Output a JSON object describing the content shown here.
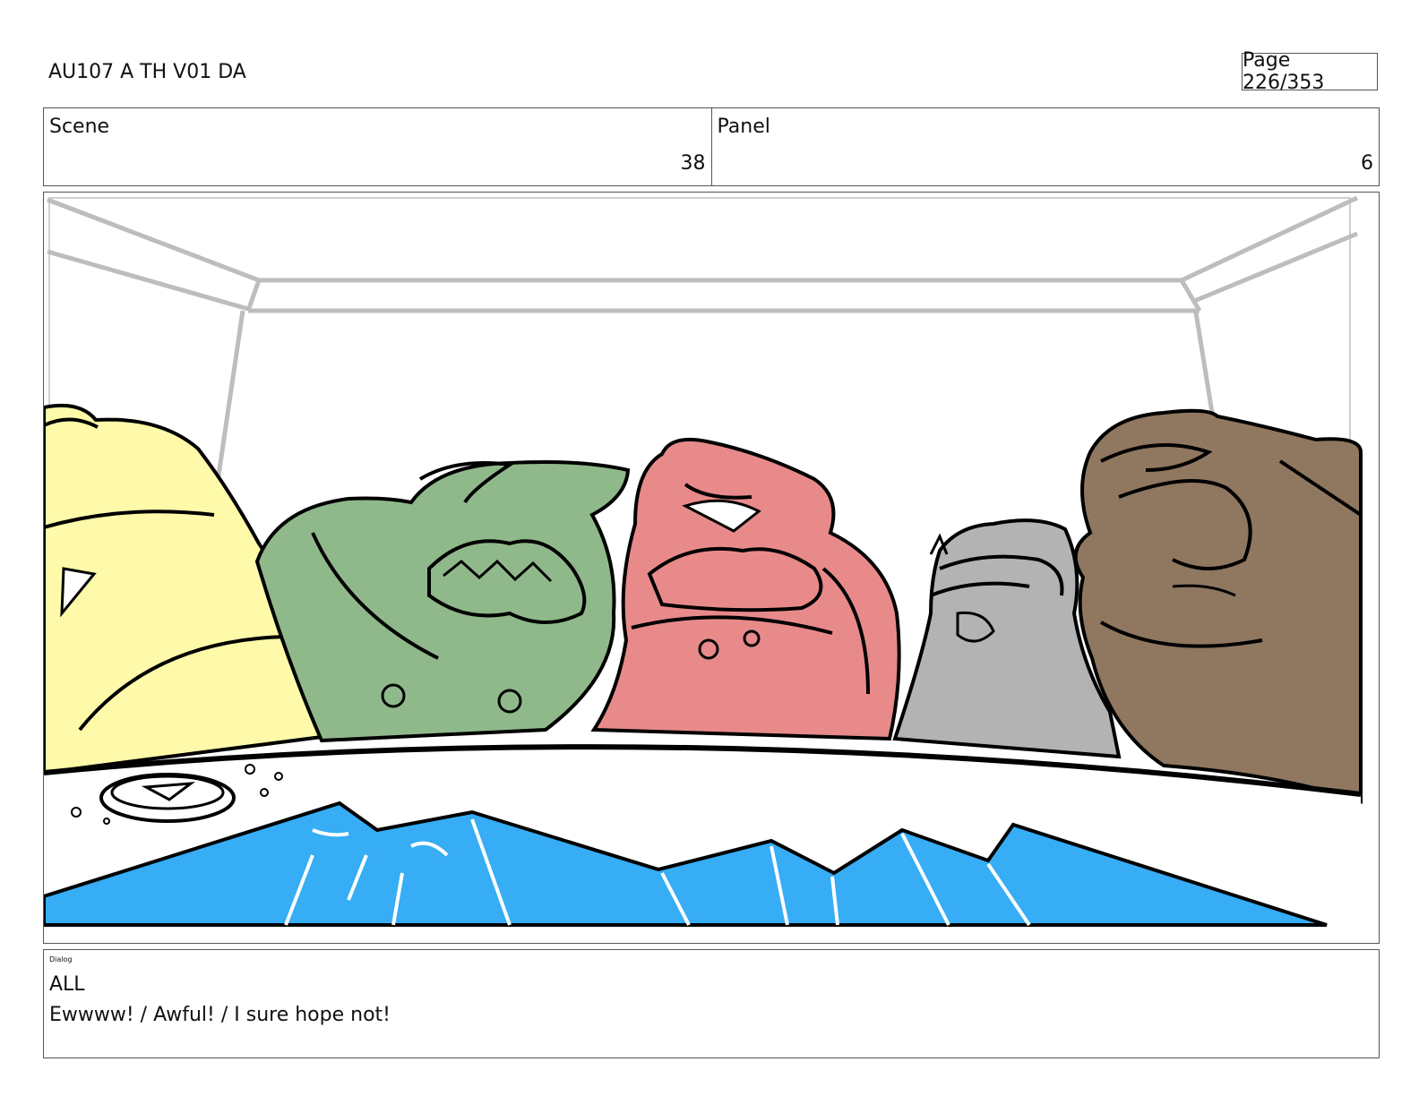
{
  "header": {
    "doc_title": "AU107 A TH V01 DA",
    "page_label": "Page 226/353"
  },
  "info": {
    "scene_label": "Scene",
    "scene_value": "38",
    "panel_label": "Panel",
    "panel_value": "6"
  },
  "illustration": {
    "colors": {
      "yellow": "#FFFAAA",
      "green": "#8FB98A",
      "pink": "#E88A8A",
      "gray": "#B3B3B3",
      "brown": "#8F7760",
      "water": "#36ADF5",
      "ceiling_lines": "#BDBDBD"
    }
  },
  "dialog": {
    "label": "Dialog",
    "speaker": "ALL",
    "line": "Ewwww! / Awful! / I sure hope not!"
  }
}
